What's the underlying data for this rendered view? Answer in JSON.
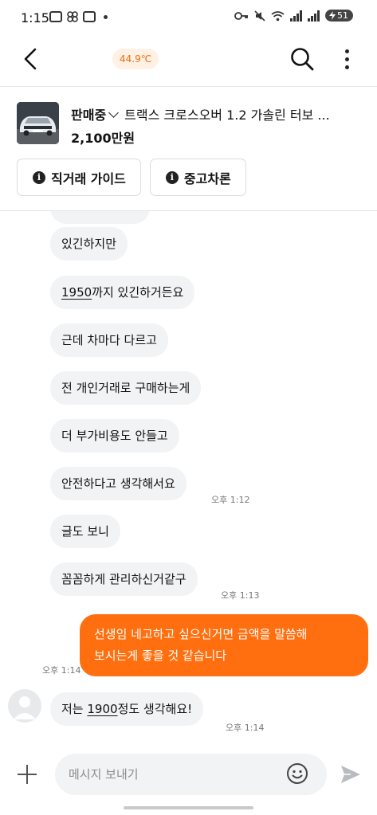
{
  "status_bar": {
    "time": "1:15",
    "battery": "51",
    "left_icons": [
      "screenshot-icon",
      "pinwheel-icon",
      "window-icon",
      "notification-dot-icon"
    ],
    "right_icons": [
      "key-icon",
      "mute-icon",
      "wifi-icon",
      "signal-icon",
      "signal-icon",
      "battery-icon"
    ]
  },
  "header": {
    "temperature": "44.9℃",
    "icons": [
      "back-arrow-icon",
      "search-icon",
      "more-vertical-icon"
    ]
  },
  "product": {
    "status": "판매중",
    "title": "트랙스 크로스오버 1.2 가솔린 터보 ...",
    "price": "2,100만원"
  },
  "guides": [
    {
      "label": "직거래 가이드",
      "icon": "info-icon"
    },
    {
      "label": "중고차론",
      "icon": "info-icon"
    }
  ],
  "messages": [
    {
      "text": "있긴하지만",
      "time": ""
    },
    {
      "prefix": "",
      "link": "1950",
      "suffix": "까지 있긴하거든요",
      "time": ""
    },
    {
      "text": "근데 차마다 다르고",
      "time": ""
    },
    {
      "text": "전 개인거래로 구매하는게",
      "time": ""
    },
    {
      "text": "더 부가비용도 안들고",
      "time": ""
    },
    {
      "text": "안전하다고 생각해서요",
      "time": "오후 1:12"
    },
    {
      "text": "글도 보니",
      "time": ""
    },
    {
      "text": "꼼꼼하게 관리하신거같구",
      "time": "오후 1:13"
    }
  ],
  "outgoing": {
    "line1": "선생임 네고하고 싶으신거면 금액을 말씀해",
    "line2": "보시는게 좋을 것 같습니다",
    "time": "오후 1:14"
  },
  "last_incoming": {
    "prefix": "저는 ",
    "link": "1900",
    "suffix": "정도 생각해요!",
    "time": "오후 1:14"
  },
  "input": {
    "placeholder": "메시지 보내기",
    "icons": [
      "plus-icon",
      "emoji-icon",
      "send-icon"
    ]
  },
  "colors": {
    "accent": "#ff6f0f",
    "temp_bg": "#fff1e4",
    "bubble_incoming": "#f2f3f5"
  }
}
